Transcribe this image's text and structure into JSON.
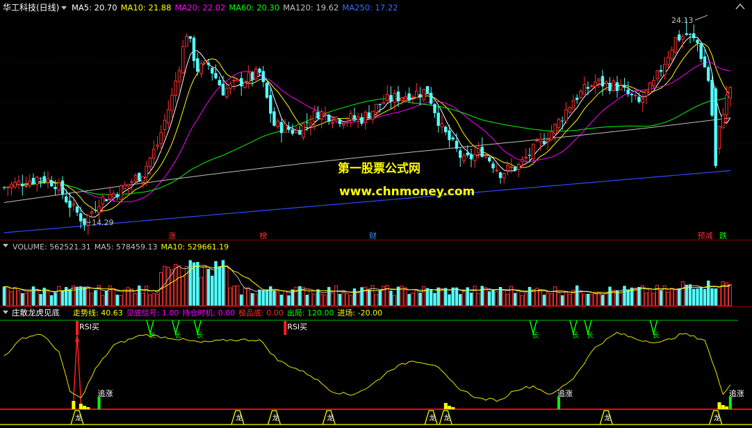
{
  "main_header": {
    "stock_name": "华工科技(日线)",
    "ma_labels": [
      {
        "text": "MA5: 20.70",
        "color": "#ffffff"
      },
      {
        "text": "MA10: 21.88",
        "color": "#ffff00"
      },
      {
        "text": "MA20: 22.02",
        "color": "#ff00ff"
      },
      {
        "text": "MA60: 20.30",
        "color": "#00ff00"
      },
      {
        "text": "MA120: 19.62",
        "color": "#c0c0c0"
      },
      {
        "text": "MA250: 17.22",
        "color": "#3a6cff"
      }
    ]
  },
  "volume_header": {
    "labels": [
      {
        "text": "VOLUME: 562521.31",
        "color": "#c0c0c0"
      },
      {
        "text": "MA5: 578459.13",
        "color": "#c0c0c0"
      },
      {
        "text": "MA10: 529661.19",
        "color": "#ffff00"
      }
    ]
  },
  "indicator_header": {
    "name": "庄散龙虎见底",
    "labels": [
      {
        "text": "走势线: 40.63",
        "color": "#ffff00"
      },
      {
        "text": "见底信号: 1.00",
        "color": "#ff00ff"
      },
      {
        "text": "持仓时机: 0.00",
        "color": "#ff00ff"
      },
      {
        "text": "极品底: 0.00",
        "color": "#ff3030"
      },
      {
        "text": "出局: 120.00",
        "color": "#00ff00"
      },
      {
        "text": "进场: -20.00",
        "color": "#ffff00"
      }
    ]
  },
  "watermark": {
    "line1": "第一股票公式网",
    "line2": "www.chnmoney.com"
  },
  "price_annotations": {
    "high": "24.13",
    "low": "14.29"
  },
  "event_markers": [
    {
      "text": "涨",
      "color": "#ff3030",
      "index": 45
    },
    {
      "text": "榜",
      "color": "#ff3030",
      "index": 70
    },
    {
      "text": "财",
      "color": "#3a8cff",
      "index": 100
    },
    {
      "text": "预减",
      "color": "#ff3030",
      "index": 190
    },
    {
      "text": "跌",
      "color": "#00ff00",
      "index": 196
    }
  ],
  "signals": {
    "rsi_buy_label": "RSI买",
    "chase_label": "追涨",
    "long_label": "长",
    "dragon_label": "龙"
  },
  "chart_data": [
    {
      "type": "candlestick",
      "title": "华工科技(日线)",
      "ylim": [
        13.5,
        25
      ],
      "high_label": 24.13,
      "low_label": 14.29,
      "rise_color": "#ff3030",
      "fall_color": "#54ffff",
      "series_names": [
        "MA5",
        "MA10",
        "MA20",
        "MA60",
        "MA120",
        "MA250"
      ]
    },
    {
      "type": "bar",
      "title": "VOLUME",
      "last_values": {
        "VOLUME": 562521.31,
        "MA5": 578459.13,
        "MA10": 529661.19
      }
    },
    {
      "type": "line",
      "title": "庄散龙虎见底",
      "last_values": {
        "走势线": 40.63,
        "见底信号": 1.0,
        "持仓时机": 0.0,
        "极品底": 0.0,
        "出局": 120.0,
        "进场": -20.0
      },
      "ylim": [
        -20,
        120
      ]
    }
  ]
}
